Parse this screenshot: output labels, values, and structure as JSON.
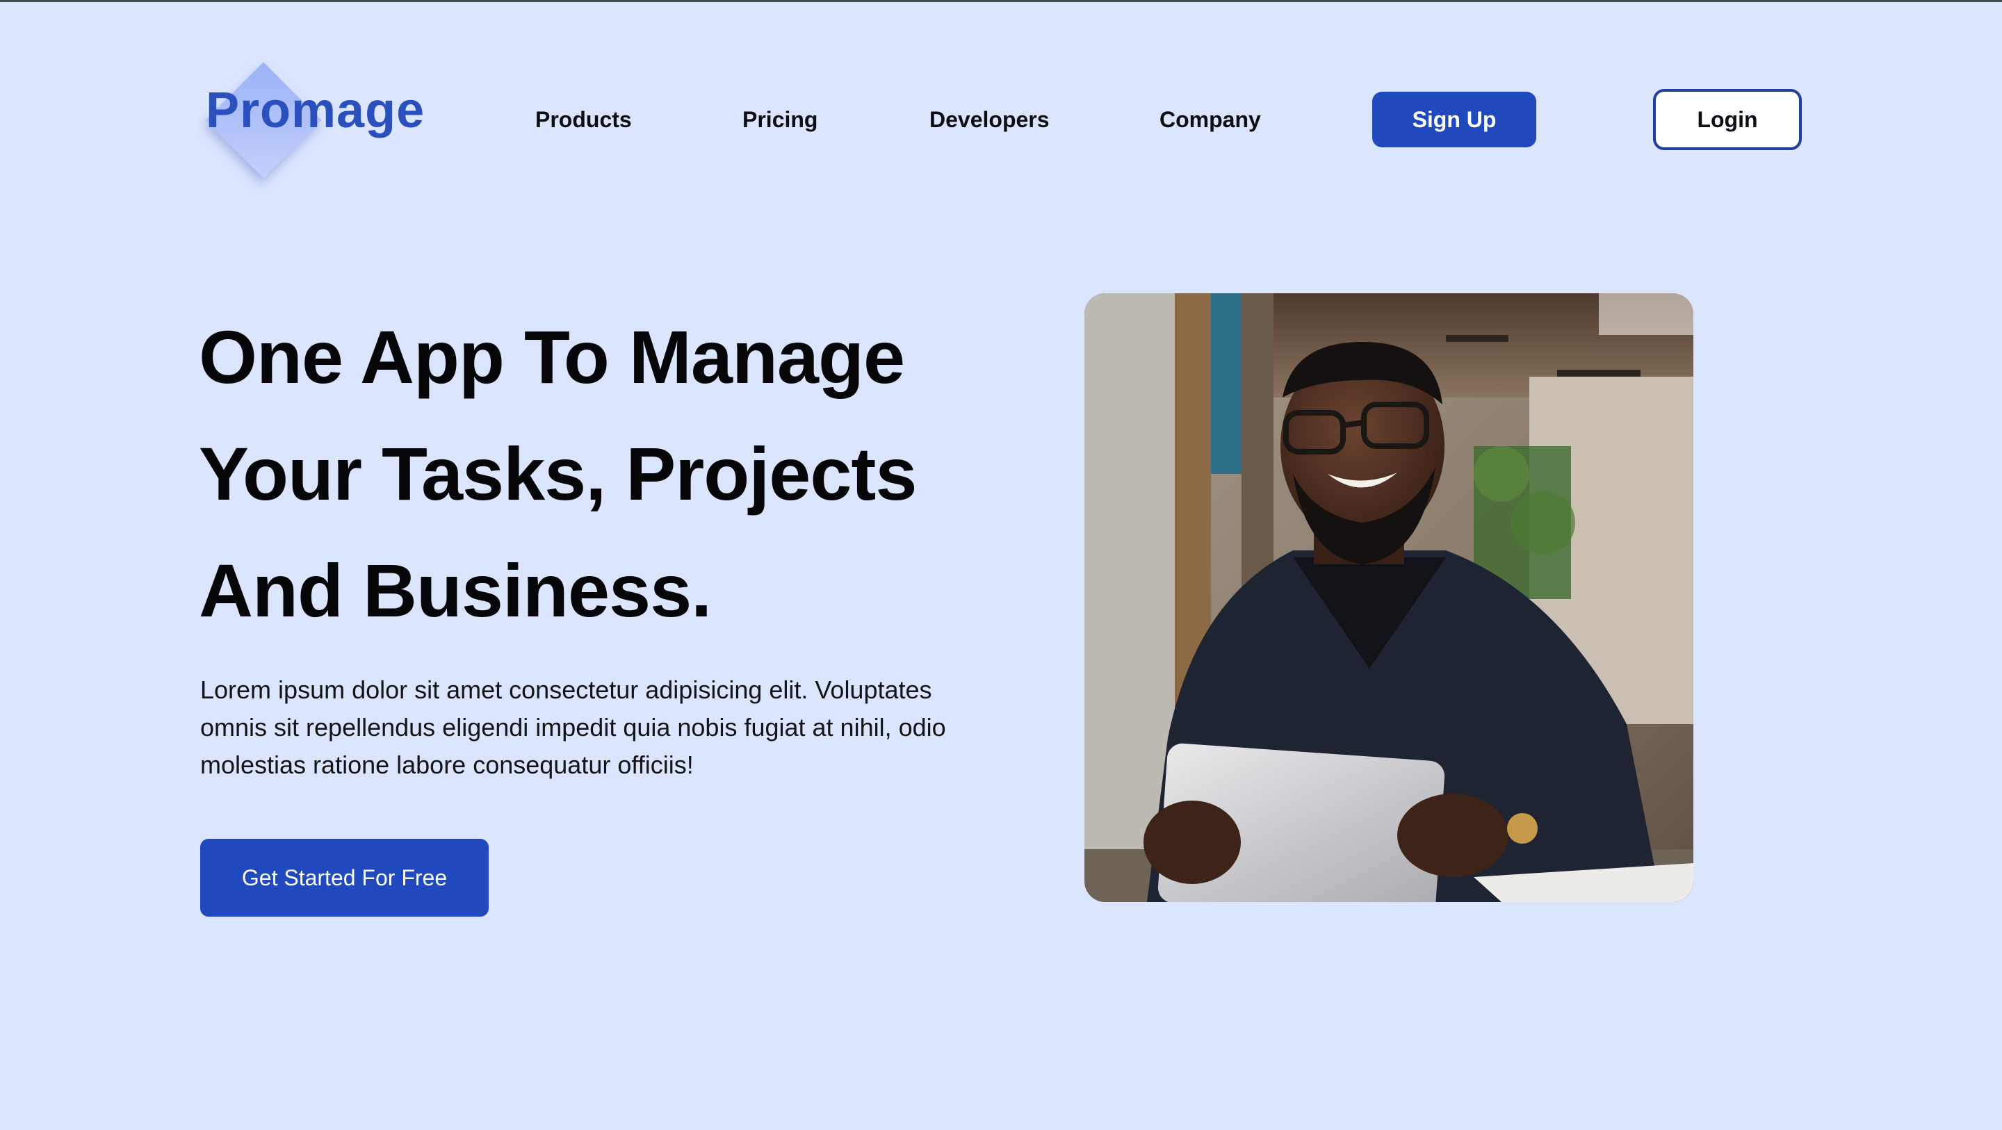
{
  "brand": {
    "name": "Promage",
    "color": "#2a50bd"
  },
  "nav": {
    "items": [
      {
        "label": "Products"
      },
      {
        "label": "Pricing"
      },
      {
        "label": "Developers"
      },
      {
        "label": "Company"
      }
    ],
    "signup_label": "Sign Up",
    "login_label": "Login"
  },
  "hero": {
    "title_lines": [
      "One App To Manage",
      "Your Tasks, Projects",
      "And Business."
    ],
    "description": "Lorem ipsum dolor sit amet consectetur adipisicing elit. Voluptates omnis sit repellendus eligendi impedit quia nobis fugiat at nihil, odio molestias ratione labore consequatur officiis!",
    "cta_label": "Get Started For Free"
  },
  "colors": {
    "background": "#dbe5fd",
    "primary": "#2149be",
    "login_border": "#1f3f9c"
  }
}
